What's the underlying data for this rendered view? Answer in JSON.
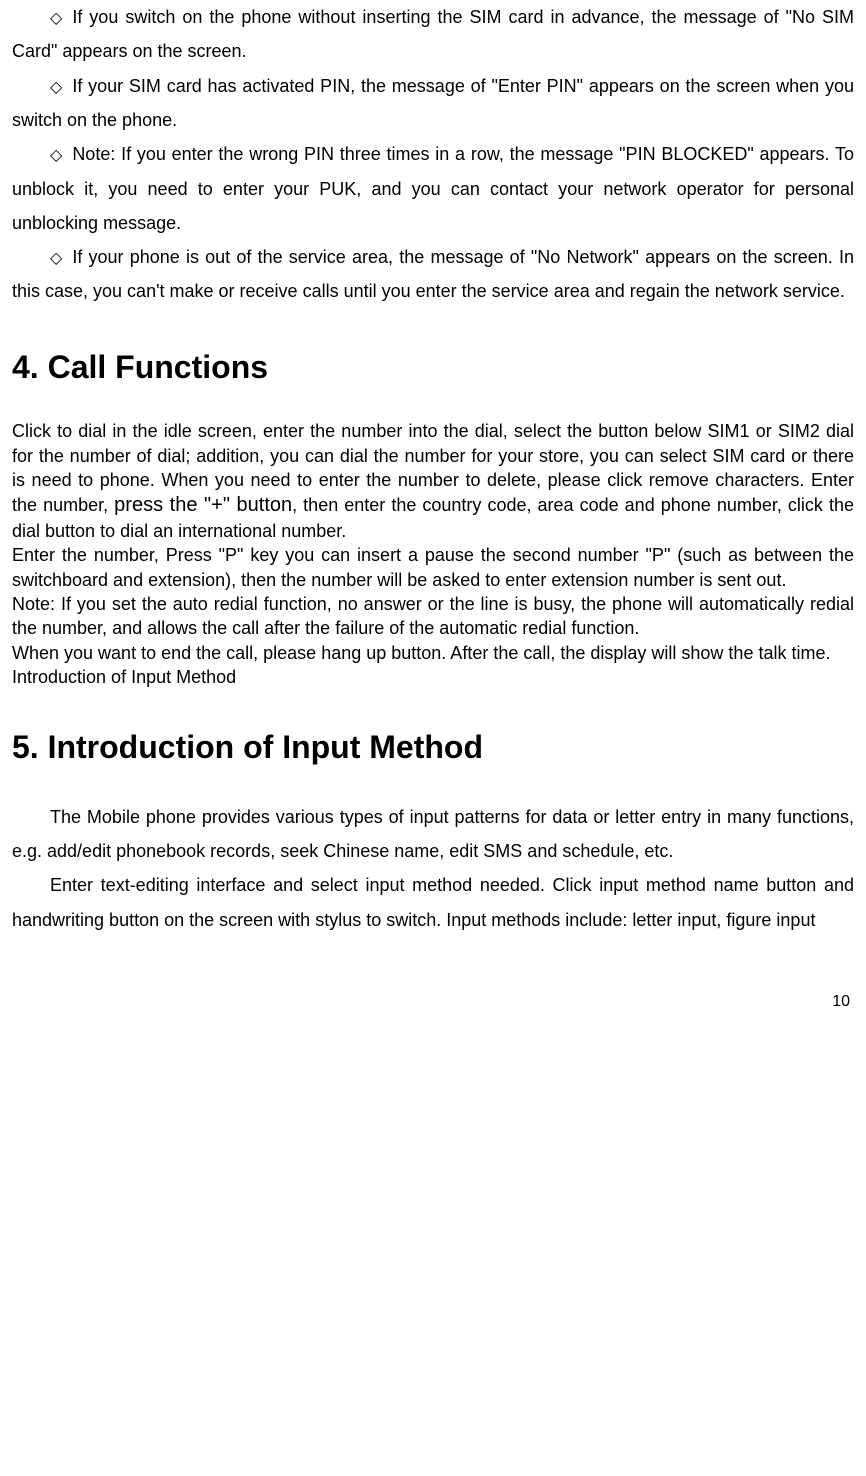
{
  "diamond_glyph": "◇",
  "bullets": {
    "b1": "If you switch on the phone without inserting the SIM card in advance, the message of \"No SIM Card\" appears on the screen.",
    "b2": "If your SIM card has activated PIN, the message of \"Enter PIN\" appears on the screen when you switch on the phone.",
    "b3": "Note: If you enter the wrong PIN three times in a row, the message \"PIN BLOCKED\" appears. To unblock it, you need to enter your PUK, and you can contact your network operator for personal unblocking message.",
    "b4": "If your phone is out of the service area, the message of \"No Network\" appears on the screen. In this case, you can't make or receive calls until you enter the service area and regain the network service."
  },
  "section4": {
    "heading": "4. Call Functions",
    "p1_part1": "Click to dial in the idle screen, enter the number into the dial, select the button below SIM1 or SIM2 dial for the number of dial; addition, you can dial the number for your store, you can select SIM card or there is need to phone. When you need to enter the number to delete, please click remove characters. Enter the number, ",
    "p1_press": "press the \"+\" button",
    "p1_part2": ", then enter the country code, area code and phone number, click the dial button to dial an international number.",
    "p2": "Enter the number, Press \"P\" key you can insert a pause the second number \"P\" (such as between the switchboard and extension), then the number will be asked to enter extension number is sent out.",
    "p3": "Note: If you set the auto redial function, no answer or the line is busy, the phone will automatically redial the number, and allows the call after the failure of the automatic redial function.",
    "p4": "When you want to end the call, please hang up button. After the call, the display will show the talk time.",
    "p5": "Introduction of Input Method"
  },
  "section5": {
    "heading": "5. Introduction of Input Method",
    "p1": "The Mobile phone provides various types of input patterns for data or letter entry in many functions, e.g. add/edit phonebook records, seek Chinese name, edit SMS and schedule, etc.",
    "p2": "Enter text-editing interface and select input method needed. Click input method name button and handwriting button on the screen with stylus to switch. Input methods include: letter input, figure input"
  },
  "page_number": "10"
}
